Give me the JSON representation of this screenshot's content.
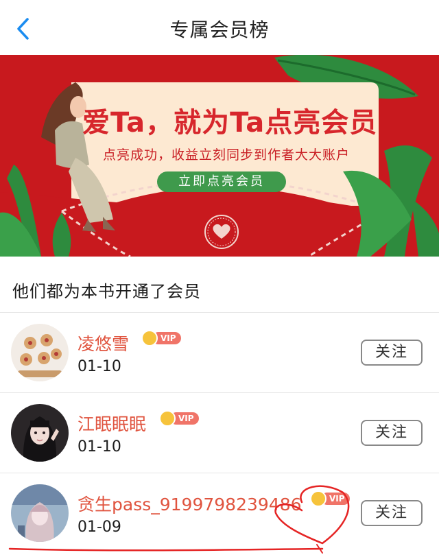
{
  "header": {
    "title": "专属会员榜",
    "back_icon": "chevron-left-icon"
  },
  "banner": {
    "title": "爱Ta，就为Ta点亮会员",
    "subtitle": "点亮成功，收益立刻同步到作者大大账户",
    "button_label": "立即点亮会员",
    "colors": {
      "background": "#c8191e",
      "card": "#fde9d2",
      "button": "#3f9a4c"
    }
  },
  "section": {
    "title": "他们都为本书开通了会员"
  },
  "members": [
    {
      "name": "凌悠雪",
      "badge": "VIP",
      "date": "01-10",
      "follow_label": "关注",
      "avatar_icon": "cookies-photo-avatar"
    },
    {
      "name": "江眠眠眠",
      "badge": "VIP",
      "date": "01-10",
      "follow_label": "关注",
      "avatar_icon": "girl-portrait-avatar"
    },
    {
      "name": "贪生pass_9199798239486",
      "badge": "VIP",
      "date": "01-09",
      "follow_label": "关注",
      "avatar_icon": "anime-girl-avatar"
    }
  ],
  "colors": {
    "name_red": "#e0543f",
    "vip_pink": "#f07468",
    "crown_gold": "#f6c33b",
    "annotation_red": "#e52424"
  }
}
